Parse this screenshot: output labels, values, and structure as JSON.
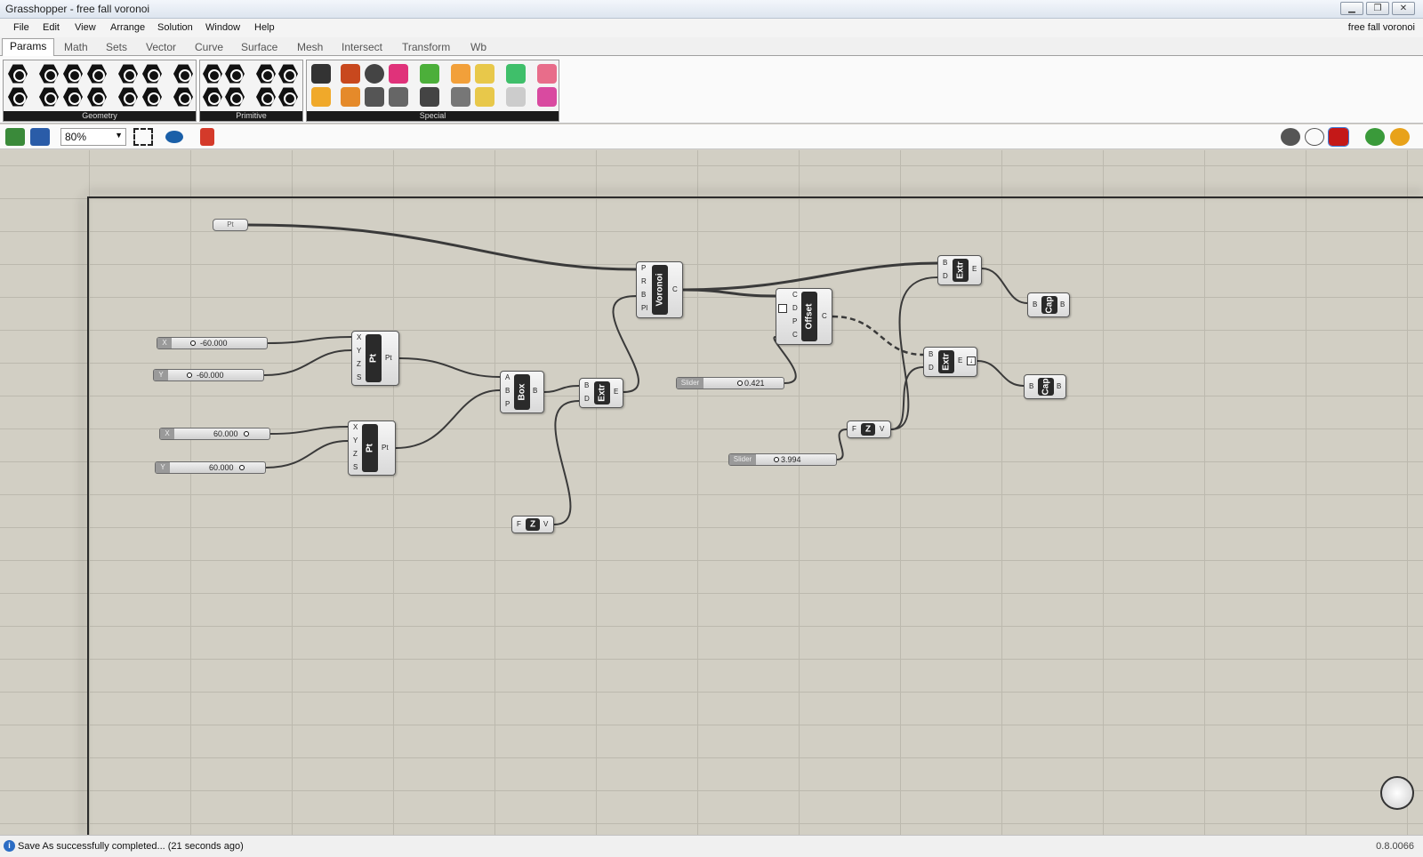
{
  "window": {
    "title": "Grasshopper - free fall voronoi",
    "doc_name": "free fall voronoi"
  },
  "menu": [
    "File",
    "Edit",
    "View",
    "Arrange",
    "Solution",
    "Window",
    "Help"
  ],
  "tabs": [
    "Params",
    "Math",
    "Sets",
    "Vector",
    "Curve",
    "Surface",
    "Mesh",
    "Intersect",
    "Transform",
    "Wb"
  ],
  "active_tab": "Params",
  "ribbon_panels": [
    "Geometry",
    "Primitive",
    "Special"
  ],
  "zoom": "80%",
  "components": {
    "pt_param": "Pt",
    "voronoi": {
      "name": "Voronoi",
      "inputs": [
        "P",
        "R",
        "B",
        "Pl"
      ],
      "outputs": [
        "C"
      ]
    },
    "pt1": {
      "name": "Pt",
      "inputs": [
        "X",
        "Y",
        "Z",
        "S"
      ],
      "outputs": [
        "Pt"
      ]
    },
    "pt2": {
      "name": "Pt",
      "inputs": [
        "X",
        "Y",
        "Z",
        "S"
      ],
      "outputs": [
        "Pt"
      ]
    },
    "box": {
      "name": "Box",
      "inputs": [
        "A",
        "B",
        "P"
      ],
      "outputs": [
        "B"
      ]
    },
    "extr1": {
      "name": "Extr",
      "inputs": [
        "B",
        "D"
      ],
      "outputs": [
        "E"
      ]
    },
    "offset": {
      "name": "Offset",
      "inputs": [
        "C",
        "D",
        "P",
        "C"
      ],
      "outputs": [
        "C"
      ]
    },
    "extr2": {
      "name": "Extr",
      "inputs": [
        "B",
        "D"
      ],
      "outputs": [
        "E"
      ]
    },
    "extr3": {
      "name": "Extr",
      "inputs": [
        "B",
        "D"
      ],
      "outputs": [
        "E"
      ]
    },
    "cap1": {
      "name": "Cap",
      "inputs": [
        "B"
      ],
      "outputs": [
        "B"
      ]
    },
    "cap2": {
      "name": "Cap",
      "inputs": [
        "B"
      ],
      "outputs": [
        "B"
      ]
    },
    "z1": {
      "name": "Z",
      "inputs": [
        "F"
      ],
      "outputs": [
        "V"
      ]
    },
    "z2": {
      "name": "Z",
      "inputs": [
        "F"
      ],
      "outputs": [
        "V"
      ]
    }
  },
  "sliders": {
    "x1": {
      "tag": "X",
      "value": "-60.000"
    },
    "y1": {
      "tag": "Y",
      "value": "-60.000"
    },
    "x2": {
      "tag": "X",
      "value": "60.000"
    },
    "y2": {
      "tag": "Y",
      "value": "60.000"
    },
    "s1": {
      "tag": "Slider",
      "value": "0.421"
    },
    "s2": {
      "tag": "Slider",
      "value": "3.994"
    }
  },
  "status": {
    "message": "Save As successfully completed... (21 seconds ago)",
    "version": "0.8.0066"
  },
  "colors": {
    "canvas": "#d2cfc4",
    "grid": "#bcb9ae",
    "component_core": "#2a2a2a",
    "wire": "#3a3a3a"
  }
}
